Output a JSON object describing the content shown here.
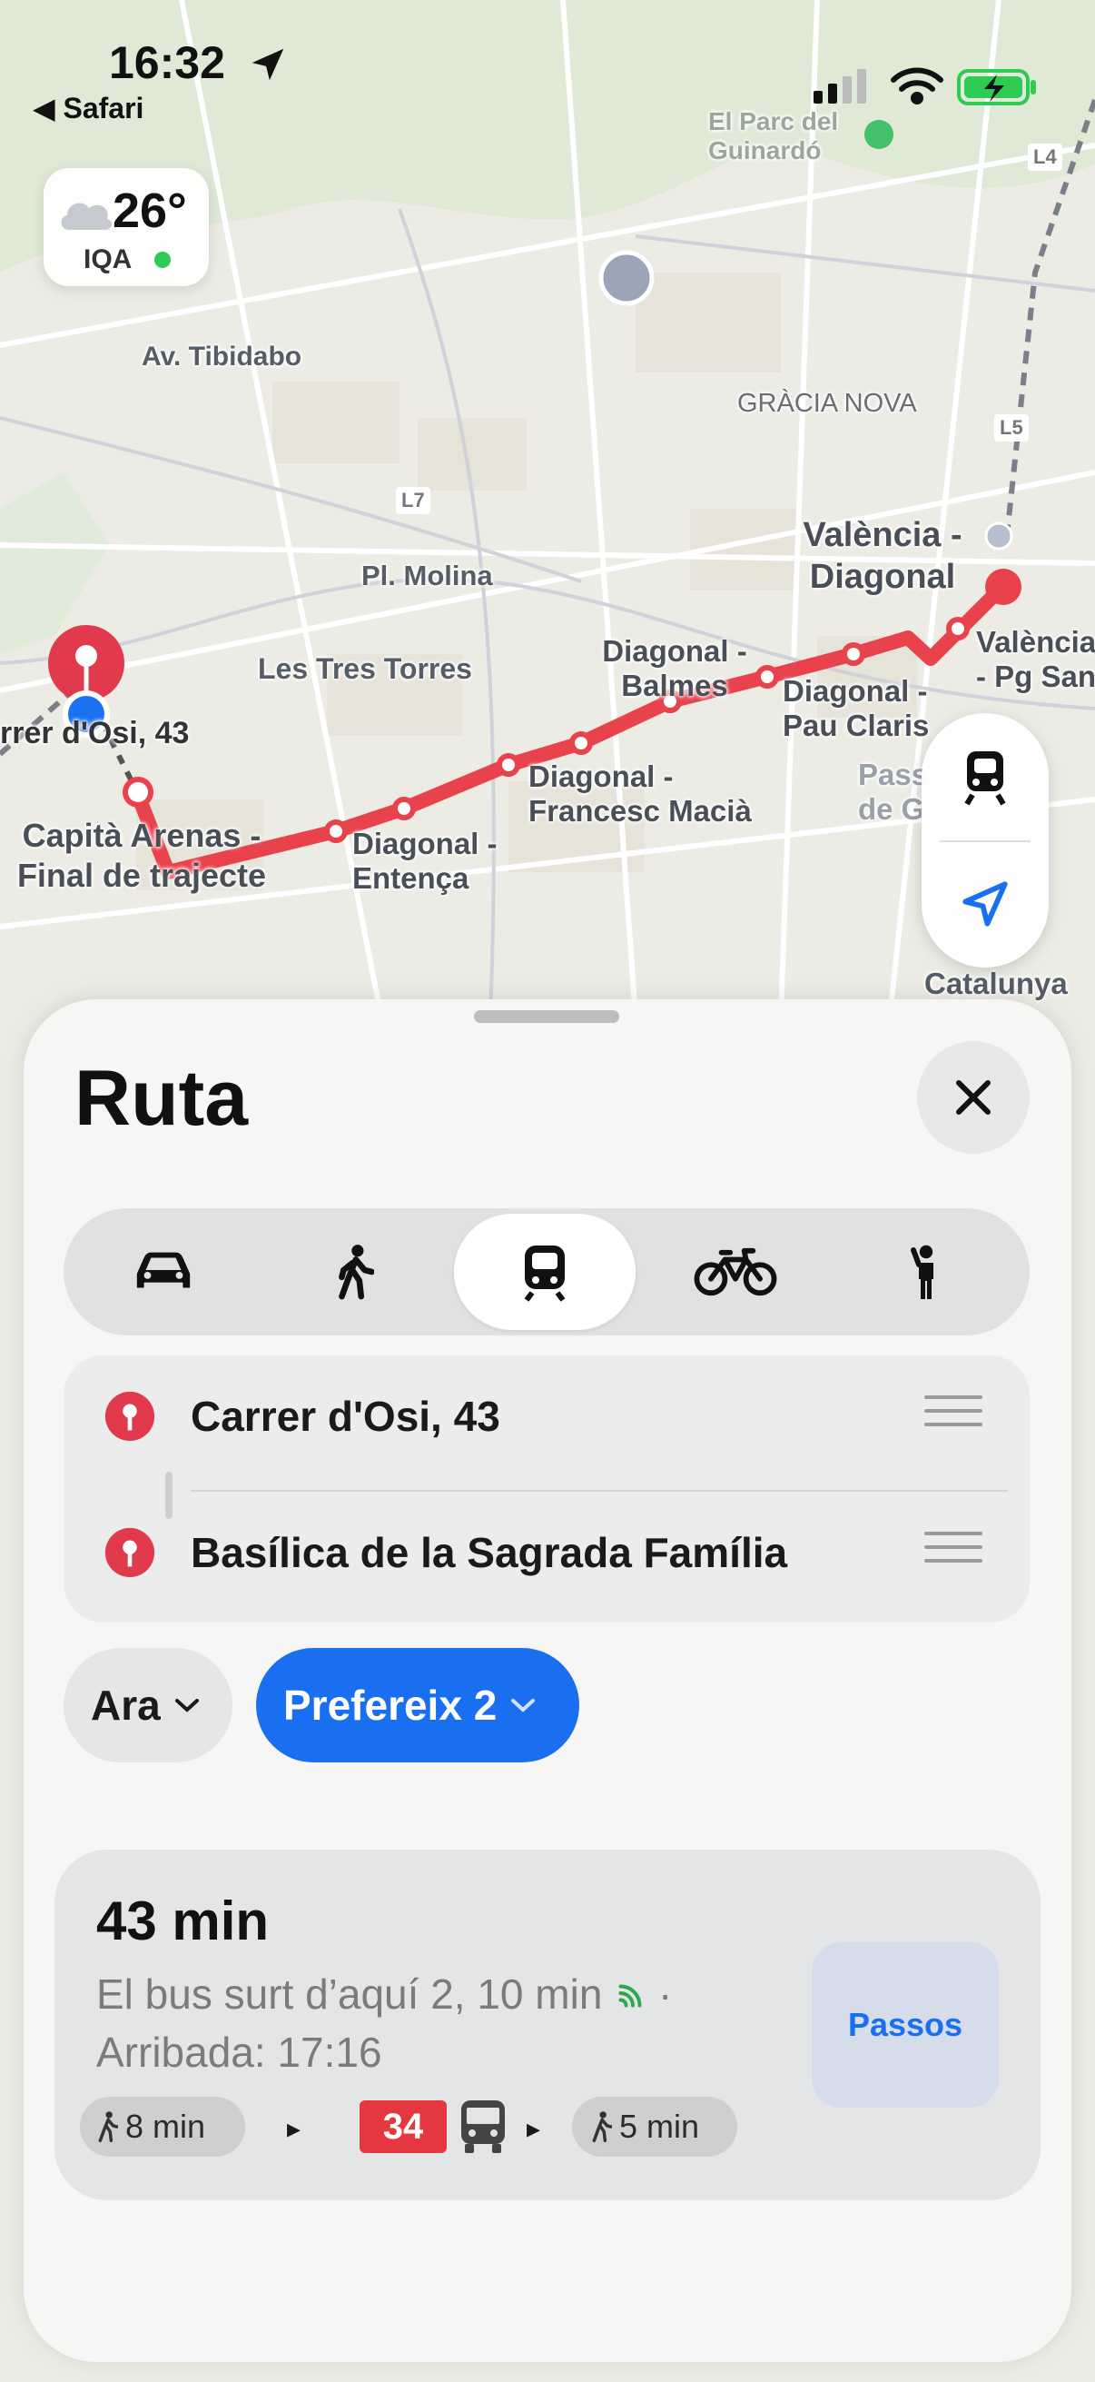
{
  "status": {
    "time": "16:32",
    "back_app": "Safari"
  },
  "weather": {
    "temperature": "26°",
    "aqi_label": "IQA"
  },
  "map": {
    "labels": {
      "park": "El Parc del Guinardó",
      "tibidabo": "Av. Tibidabo",
      "gracia": "GRÀCIA NOVA",
      "molina": "Pl. Molina",
      "tres_torres": "Les Tres Torres",
      "origin_street": "Carrer d'Osi, 43",
      "origin_street_partial": "rrer d'Osi, 43",
      "catalunya": "Catalunya",
      "l7": "L7",
      "l5": "L5",
      "l4": "L4"
    },
    "stations": {
      "capita": "Capità Arenas - Final de trajecte",
      "entenca": "Diagonal - Entença",
      "macia": "Diagonal - Francesc Macià",
      "balmes": "Diagonal - Balmes",
      "pau_claris": "Diagonal - Pau Claris",
      "valencia_diagonal": "València - Diagonal",
      "valencia_pg": "València - Pg Sant",
      "passeig": "Pass de G"
    }
  },
  "sheet": {
    "title": "Ruta",
    "modes": [
      {
        "name": "car",
        "label": "Cotxe"
      },
      {
        "name": "walk",
        "label": "A peu"
      },
      {
        "name": "transit",
        "label": "Transport públic",
        "selected": true
      },
      {
        "name": "bike",
        "label": "Bicicleta"
      },
      {
        "name": "ride",
        "label": "Taxi"
      }
    ],
    "origin": "Carrer d'Osi, 43",
    "destination": "Basílica de la Sagrada Família",
    "time_option": "Ara",
    "preference_option": "Prefereix 2"
  },
  "result": {
    "duration": "43 min",
    "departure": "El bus surt d’aquí 2, 10 min",
    "arrival": "Arribada: 17:16",
    "walk_start": "8 min",
    "bus_line": "34",
    "walk_end": "5 min",
    "steps_label": "Passos"
  },
  "colors": {
    "route": "#e8434c",
    "accent": "#1a6ff0",
    "location": "#1b72f0"
  }
}
